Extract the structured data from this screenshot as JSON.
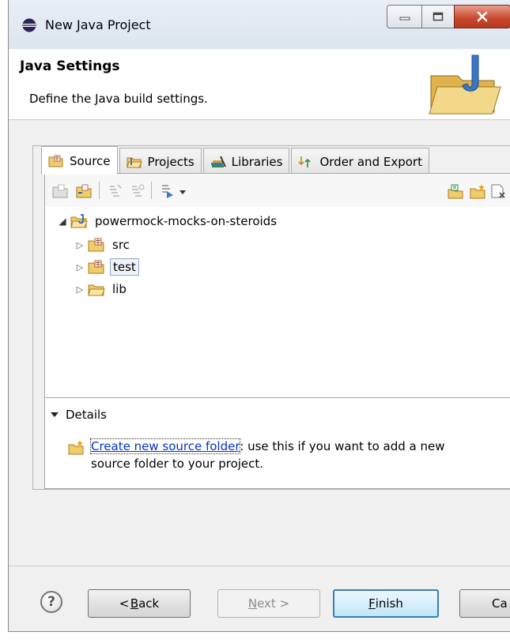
{
  "window": {
    "title": "New Java Project"
  },
  "header": {
    "title": "Java Settings",
    "description": "Define the Java build settings."
  },
  "tabs": [
    {
      "label": "Source",
      "active": true
    },
    {
      "label": "Projects",
      "active": false
    },
    {
      "label": "Libraries",
      "active": false
    },
    {
      "label": "Order and Export",
      "active": false
    }
  ],
  "tree": {
    "project": "powermock-mocks-on-steroids",
    "children": [
      {
        "label": "src"
      },
      {
        "label": "test",
        "selected": true
      },
      {
        "label": "lib"
      }
    ]
  },
  "details": {
    "heading": "Details",
    "link_text": "Create new source folder",
    "text_rest": ": use this if you want to add a new",
    "text_line2": "source folder to your project."
  },
  "buttons": {
    "help": "?",
    "back_prefix": "< ",
    "back_mnemonic": "B",
    "back_rest": "ack",
    "next_mnemonic": "N",
    "next_rest": "ext >",
    "finish_mnemonic": "F",
    "finish_rest": "inish",
    "cancel_visible": "Ca"
  },
  "colors": {
    "link": "#0033cc",
    "folder": "#e8b64a",
    "close_button": "#c8462c",
    "default_button_border": "#3c7fb1"
  }
}
